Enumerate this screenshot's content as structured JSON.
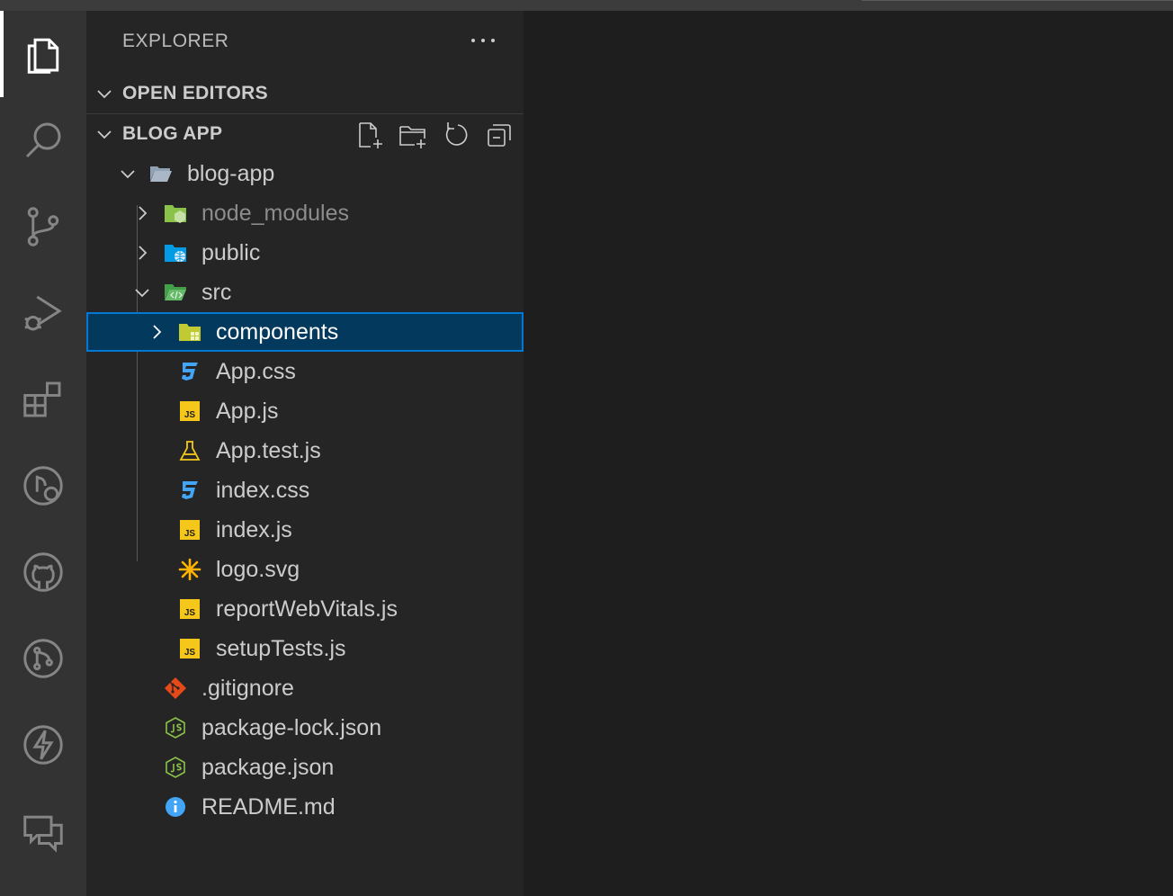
{
  "sidebar": {
    "title": "EXPLORER",
    "sections": {
      "open_editors": "OPEN EDITORS",
      "project": "BLOG APP"
    }
  },
  "activity_bar": [
    {
      "name": "explorer-icon",
      "active": true
    },
    {
      "name": "search-icon"
    },
    {
      "name": "source-control-icon"
    },
    {
      "name": "run-debug-icon"
    },
    {
      "name": "extensions-icon"
    },
    {
      "name": "remote-explorer-icon"
    },
    {
      "name": "github-icon"
    },
    {
      "name": "pull-requests-icon"
    },
    {
      "name": "lightning-icon"
    },
    {
      "name": "live-share-chat-icon"
    }
  ],
  "tree": {
    "root": "blog-app",
    "node_modules": "node_modules",
    "public": "public",
    "src": "src",
    "components": "components",
    "app_css": "App.css",
    "app_js": "App.js",
    "app_test": "App.test.js",
    "index_css": "index.css",
    "index_js": "index.js",
    "logo": "logo.svg",
    "report": "reportWebVitals.js",
    "setup": "setupTests.js",
    "gitignore": ".gitignore",
    "package_lock": "package-lock.json",
    "package": "package.json",
    "readme": "README.md"
  },
  "colors": {
    "activity_bar": "#333333",
    "sidebar": "#252526",
    "editor": "#1e1e1e",
    "selection": "#04395e",
    "focus_border": "#0078d4",
    "js_yellow": "#f5c71a",
    "css_blue": "#42a5f5"
  }
}
